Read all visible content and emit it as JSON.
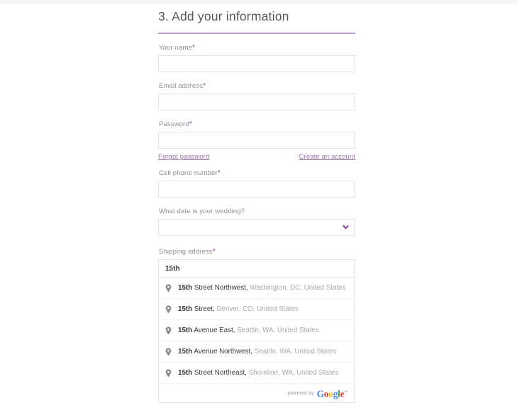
{
  "section": {
    "title": "3. Add your information"
  },
  "fields": {
    "name": {
      "label": "Your name",
      "required_marker": "*",
      "value": "",
      "placeholder": ""
    },
    "email": {
      "label": "Email address",
      "required_marker": "*",
      "value": "",
      "placeholder": ""
    },
    "password": {
      "label": "Password",
      "required_marker": "*",
      "value": "",
      "placeholder": ""
    },
    "phone": {
      "label": "Cell phone number",
      "required_marker": "*",
      "value": "",
      "placeholder": ""
    },
    "wedding_date": {
      "label": "What date is your wedding?",
      "selected": "",
      "options": [
        ""
      ]
    },
    "shipping": {
      "label": "Shipping address",
      "required_marker": "*",
      "value": "15th",
      "placeholder": ""
    }
  },
  "links": {
    "forgot_password": "Forgot password",
    "create_account": "Create an account"
  },
  "autocomplete": {
    "query": "15th",
    "suggestions": [
      {
        "match": "15th",
        "main": " Street Northwest,",
        "sub": " Washington, DC, United States"
      },
      {
        "match": "15th",
        "main": " Street,",
        "sub": " Denver, CO, United States"
      },
      {
        "match": "15th",
        "main": " Avenue East,",
        "sub": " Seattle, WA, United States"
      },
      {
        "match": "15th",
        "main": " Avenue Northwest,",
        "sub": " Seattle, WA, United States"
      },
      {
        "match": "15th",
        "main": " Street Northeast,",
        "sub": " Shoreline, WA, United States"
      }
    ],
    "attribution": {
      "prefix": "powered by",
      "brand_letters": [
        {
          "char": "G",
          "color": "#4285F4"
        },
        {
          "char": "o",
          "color": "#EA4335"
        },
        {
          "char": "o",
          "color": "#FBBC05"
        },
        {
          "char": "g",
          "color": "#4285F4"
        },
        {
          "char": "l",
          "color": "#34A853"
        },
        {
          "char": "e",
          "color": "#EA4335"
        }
      ],
      "trademark": "™"
    }
  },
  "colors": {
    "accent_purple": "#bd9fcd",
    "link_purple": "#9b6fae",
    "required_purple": "#8e3f9e",
    "label_gray": "#8e8e90",
    "border_gray": "#e2e2e4"
  }
}
